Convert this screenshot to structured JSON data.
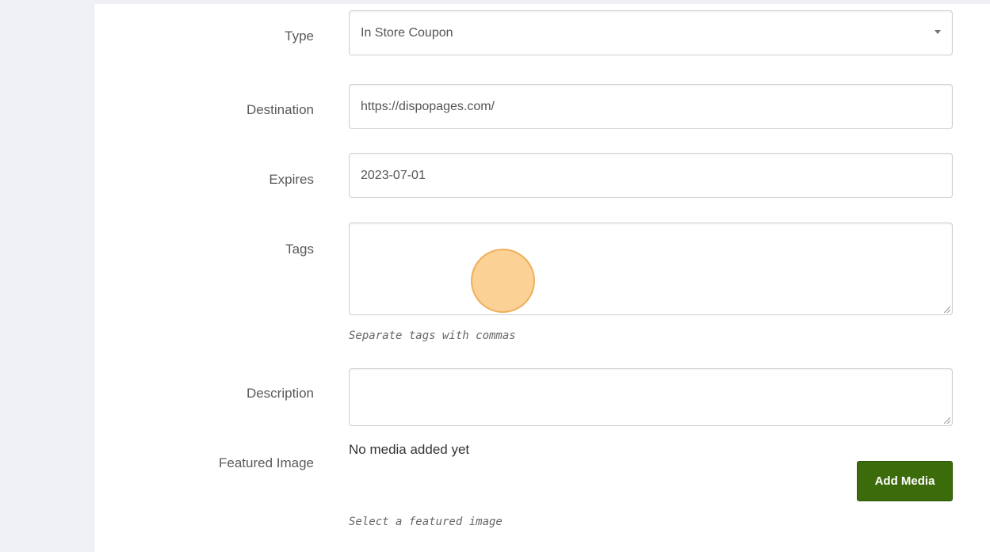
{
  "form": {
    "type": {
      "label": "Type",
      "value": "In Store Coupon"
    },
    "destination": {
      "label": "Destination",
      "value": "https://dispopages.com/"
    },
    "expires": {
      "label": "Expires",
      "value": "2023-07-01"
    },
    "tags": {
      "label": "Tags",
      "value": "",
      "help": "Separate tags with commas"
    },
    "description": {
      "label": "Description",
      "value": ""
    },
    "featured_image": {
      "label": "Featured Image",
      "status": "No media added yet",
      "button_label": "Add Media",
      "help": "Select a featured image"
    }
  },
  "colors": {
    "button_bg": "#3c6b0c",
    "cursor_highlight": "#f6c27a"
  }
}
